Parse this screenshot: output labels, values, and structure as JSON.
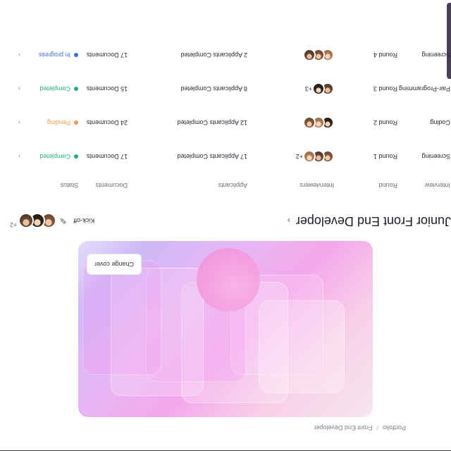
{
  "breadcrumb": [
    "Portfolio",
    "/",
    "Front End Developer"
  ],
  "banner": {
    "change_cover": "Change cover"
  },
  "page": {
    "title": "Junior Front End Developer",
    "chevron": "›"
  },
  "toolbar": {
    "kickoff": "Kick-off",
    "more_count": "+2"
  },
  "table": {
    "headers": [
      "Interview",
      "Round",
      "Interviewers",
      "Applicants",
      "Documents",
      "Status"
    ],
    "rows": [
      {
        "interview": "Screening",
        "round": "Round 1",
        "more": "+2",
        "applicants": "17 Applicants Completed",
        "documents": "17 Documents",
        "status": "Completed",
        "status_color": "#25b07a"
      },
      {
        "interview": "Coding",
        "round": "Round 2",
        "more": "",
        "applicants": "12 Applicants Completed",
        "documents": "24 Documents",
        "status": "Pending",
        "status_color": "#f29a4a"
      },
      {
        "interview": "Pair-Programming",
        "round": "Round 3",
        "more": "+3",
        "applicants": "8 Applicants Completed",
        "documents": "15 Documents",
        "status": "Completed",
        "status_color": "#25b07a"
      },
      {
        "interview": "Screening",
        "round": "Round 4",
        "more": "",
        "applicants": "2 Applicants Completed",
        "documents": "17 Documents",
        "status": "In progress",
        "status_color": "#3a6fd8"
      }
    ]
  }
}
